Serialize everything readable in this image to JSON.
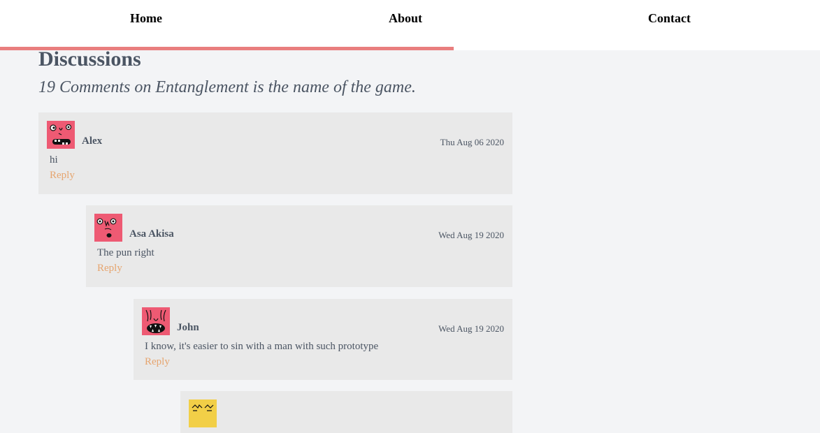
{
  "nav": {
    "items": [
      {
        "label": "Home"
      },
      {
        "label": "About"
      },
      {
        "label": "Contact"
      }
    ],
    "scroll_progress_percent": 55,
    "accent_color": "#e97e7e"
  },
  "discussion": {
    "title": "Discussions",
    "subtitle": "19 Comments on Entanglement is the name of the game."
  },
  "comments": [
    {
      "author": "Alex",
      "date": "Thu Aug 06 2020",
      "text": "hi",
      "reply_label": "Reply",
      "avatar_icon": "pink-monster-avatar-icon"
    },
    {
      "author": "Asa Akisa",
      "date": "Wed Aug 19 2020",
      "text": "The pun right",
      "reply_label": "Reply",
      "avatar_icon": "pink-monster-avatar-icon"
    },
    {
      "author": "John",
      "date": "Wed Aug 19 2020",
      "text": "I know, it's easier to sin with a man with such prototype",
      "reply_label": "Reply",
      "avatar_icon": "pink-monster-avatar-icon"
    },
    {
      "author": "",
      "date": "",
      "text": "",
      "reply_label": "",
      "avatar_icon": "yellow-monster-avatar-icon"
    }
  ],
  "colors": {
    "avatar_pink": "#ee5a73",
    "avatar_yellow": "#f2cf47",
    "reply_link": "#e6a56f",
    "card_background": "#e9e9e9",
    "page_background": "#f3f4f6"
  }
}
